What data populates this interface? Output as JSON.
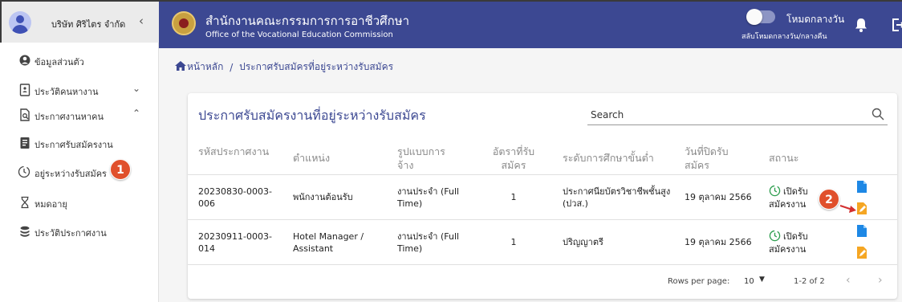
{
  "sidebar": {
    "company": "บริษัท ศิริไตร จำกัด",
    "items": [
      {
        "label": "ข้อมูลส่วนตัว"
      },
      {
        "label": "ประวัติคนหางาน"
      },
      {
        "label": "ประกาศงานหาคน"
      },
      {
        "label": "ประกาศรับสมัครงาน"
      },
      {
        "label": "อยู่ระหว่างรับสมัคร"
      },
      {
        "label": "หมดอายุ"
      },
      {
        "label": "ประวัติประกาศงาน"
      }
    ]
  },
  "topbar": {
    "title": "สำนักงานคณะกรรมการการอาชีวศึกษา",
    "subtitle": "Office of the Vocational Education Commission",
    "mode_label": "โหมดกลางวัน",
    "mode_sub": "สลับโหมดกลางวัน/กลางคืน"
  },
  "breadcrumb": {
    "home": "หน้าหลัก",
    "separator": "/",
    "current": "ประกาศรับสมัครที่อยู่ระหว่างรับสมัคร"
  },
  "card": {
    "title": "ประกาศรับสมัครงานที่อยู่ระหว่างรับสมัคร",
    "search_placeholder": "Search"
  },
  "table": {
    "headers": [
      {
        "l1": "รหัสประกาศงาน",
        "l2": ""
      },
      {
        "l1": "ตำแหน่ง",
        "l2": ""
      },
      {
        "l1": "รูปแบบการ",
        "l2": "จ้าง"
      },
      {
        "l1": "อัตราที่รับ",
        "l2": "สมัคร"
      },
      {
        "l1": "ระดับการศึกษาขั้นต่ำ",
        "l2": ""
      },
      {
        "l1": "วันที่ปิดรับ",
        "l2": "สมัคร"
      },
      {
        "l1": "สถานะ",
        "l2": ""
      }
    ],
    "rows": [
      {
        "code_l1": "20230830-0003-",
        "code_l2": "006",
        "position_l1": "พนักงานต้อนรับ",
        "position_l2": "",
        "type_l1": "งานประจำ (Full",
        "type_l2": "Time)",
        "count": "1",
        "edu_l1": "ประกาศนียบัตรวิชาชีพชั้นสูง",
        "edu_l2": "(ปวส.)",
        "close": "19 ตุลาคม 2566",
        "status_l1": "เปิดรับ",
        "status_l2": "สมัครงาน"
      },
      {
        "code_l1": "20230911-0003-",
        "code_l2": "014",
        "position_l1": "Hotel Manager /",
        "position_l2": "Assistant",
        "type_l1": "งานประจำ (Full",
        "type_l2": "Time)",
        "count": "1",
        "edu_l1": "ปริญญาตรี",
        "edu_l2": "",
        "close": "19 ตุลาคม 2566",
        "status_l1": "เปิดรับ",
        "status_l2": "สมัครงาน"
      }
    ]
  },
  "footer": {
    "rows_label": "Rows per page:",
    "rows_value": "10",
    "range": "1-2 of 2"
  },
  "annotations": {
    "badge1": "1",
    "badge2": "2"
  },
  "colors": {
    "primary": "#3c4892",
    "badge": "#e0502c",
    "status_green": "#2e9e4f",
    "view_icon": "#1e88e5",
    "edit_icon": "#f5a623",
    "arrow": "#d32f2f"
  },
  "icons": [
    "person-icon",
    "resume-icon",
    "job-search-icon",
    "announcement-icon",
    "clock-icon",
    "hourglass-icon",
    "stack-icon",
    "bell-icon",
    "logout-icon",
    "home-icon",
    "search-icon",
    "document-icon",
    "edit-icon"
  ]
}
